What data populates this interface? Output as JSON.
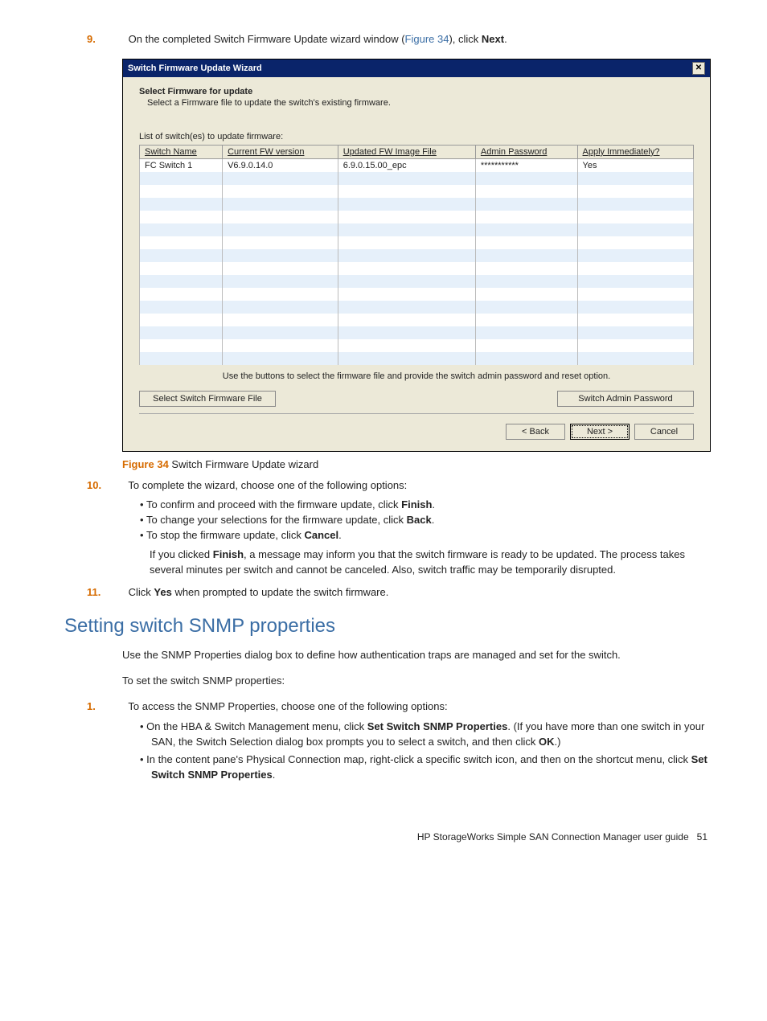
{
  "step9": {
    "num": "9.",
    "text_before": "On the completed Switch Firmware Update wizard window (",
    "figref": "Figure 34",
    "text_mid": "), click ",
    "bold": "Next",
    "text_after": "."
  },
  "wizard": {
    "title": "Switch Firmware Update Wizard",
    "close": "✕",
    "heading": "Select Firmware for update",
    "sub": "Select a Firmware file to update the switch's existing firmware.",
    "list_label": "List of switch(es) to update firmware:",
    "columns": [
      "Switch Name",
      "Current FW version",
      "Updated FW Image File",
      "Admin Password",
      "Apply Immediately?"
    ],
    "row": [
      "FC Switch 1",
      "V6.9.0.14.0",
      "6.9.0.15.00_epc",
      "***********",
      "Yes"
    ],
    "helper": "Use the buttons to select the firmware file and provide the switch admin password and reset option.",
    "btn_select": "Select Switch Firmware File",
    "btn_pwd": "Switch Admin Password",
    "nav_back": "< Back",
    "nav_next": "Next >",
    "nav_cancel": "Cancel"
  },
  "figure": {
    "label": "Figure 34",
    "caption": " Switch Firmware Update wizard"
  },
  "step10": {
    "num": "10.",
    "text": "To complete the wizard, choose one of the following options:",
    "b1_a": "To confirm and proceed with the firmware update, click ",
    "b1_bold": "Finish",
    "b2_a": "To change your selections for the firmware update, click ",
    "b2_bold": "Back",
    "b3_a": "To stop the firmware update, click ",
    "b3_bold": "Cancel",
    "after_a": "If you clicked ",
    "after_bold": "Finish",
    "after_b": ", a message may inform you that the switch firmware is ready to be updated. The process takes several minutes per switch and cannot be canceled. Also, switch traffic may be temporarily disrupted."
  },
  "step11": {
    "num": "11.",
    "text_a": "Click ",
    "bold": "Yes",
    "text_b": " when prompted to update the switch firmware."
  },
  "section": {
    "title": "Setting switch SNMP properties",
    "p1": "Use the SNMP Properties dialog box to define how authentication traps are managed and set for the switch.",
    "p2": "To set the switch SNMP properties:",
    "s1_num": "1.",
    "s1_text": "To access the SNMP Properties, choose one of the following options:",
    "s1b1_a": "On the HBA & Switch Management menu, click ",
    "s1b1_bold": "Set Switch SNMP Properties",
    "s1b1_b": ". (If you have more than one switch in your SAN, the Switch Selection dialog box prompts you to select a switch, and then click ",
    "s1b1_bold2": "OK",
    "s1b1_c": ".)",
    "s1b2_a": "In the content pane's Physical Connection map, right-click a specific switch icon, and then on the shortcut menu, click ",
    "s1b2_bold": "Set Switch SNMP Properties",
    "s1b2_b": "."
  },
  "footer": {
    "text": "HP StorageWorks Simple SAN Connection Manager user guide",
    "page": "51"
  }
}
